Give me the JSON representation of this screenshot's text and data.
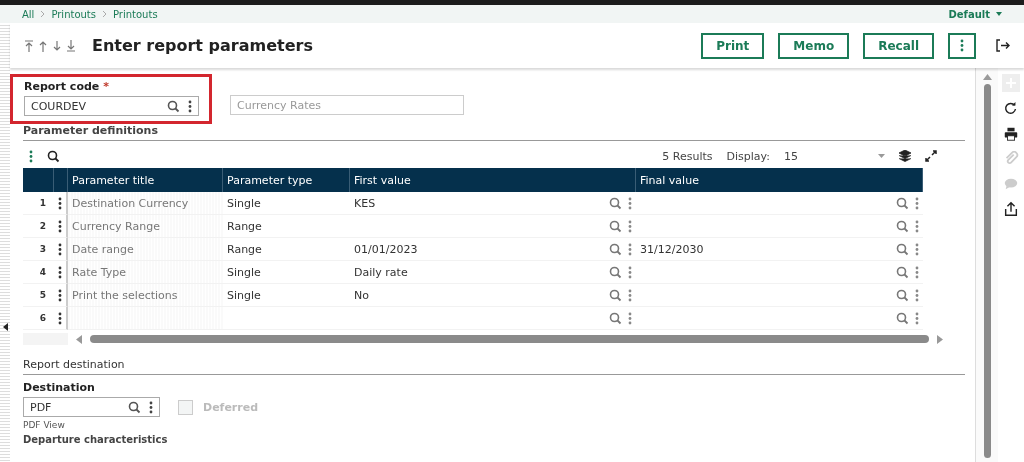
{
  "breadcrumb": [
    "All",
    "Printouts",
    "Printouts"
  ],
  "profile": "Default",
  "title": "Enter report parameters",
  "buttons": [
    "Print",
    "Memo",
    "Recall"
  ],
  "report_code": {
    "label": "Report code",
    "required_mark": "*",
    "value": "COURDEV",
    "description": "Currency Rates"
  },
  "parameter_definitions": {
    "title": "Parameter definitions",
    "results": "5 Results",
    "display_label": "Display:",
    "display_value": "15",
    "columns": [
      "Parameter title",
      "Parameter type",
      "First value",
      "Final value"
    ],
    "rows": [
      {
        "number": "1",
        "title": "Destination Currency",
        "type": "Single",
        "first_value": "KES",
        "final_value": ""
      },
      {
        "number": "2",
        "title": "Currency Range",
        "type": "Range",
        "first_value": "",
        "final_value": ""
      },
      {
        "number": "3",
        "title": "Date range",
        "type": "Range",
        "first_value": "01/01/2023",
        "final_value": "31/12/2030"
      },
      {
        "number": "4",
        "title": "Rate Type",
        "type": "Single",
        "first_value": "Daily rate",
        "final_value": ""
      },
      {
        "number": "5",
        "title": "Print the selections",
        "type": "Single",
        "first_value": "No",
        "final_value": ""
      },
      {
        "number": "6",
        "title": "",
        "type": "",
        "first_value": "",
        "final_value": ""
      }
    ]
  },
  "report_destination": {
    "title": "Report destination",
    "label": "Destination",
    "value": "PDF",
    "hint": "PDF View",
    "deferred": {
      "label": "Deferred",
      "checked": false,
      "disabled": true
    }
  },
  "next_section": "Departure characteristics",
  "side_tools": [
    {
      "kind": "add",
      "disabled": true
    },
    {
      "kind": "refresh",
      "disabled": false
    },
    {
      "kind": "print",
      "disabled": false
    },
    {
      "kind": "attach",
      "disabled": true
    },
    {
      "kind": "comment",
      "disabled": true
    },
    {
      "kind": "export",
      "disabled": false
    }
  ]
}
